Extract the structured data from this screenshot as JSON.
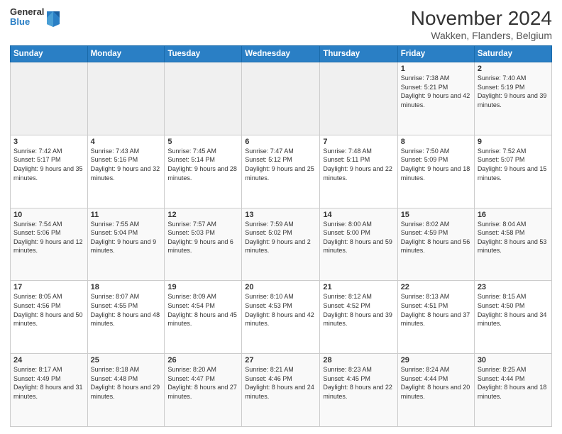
{
  "logo": {
    "line1": "General",
    "line2": "Blue"
  },
  "title": "November 2024",
  "subtitle": "Wakken, Flanders, Belgium",
  "days_header": [
    "Sunday",
    "Monday",
    "Tuesday",
    "Wednesday",
    "Thursday",
    "Friday",
    "Saturday"
  ],
  "weeks": [
    [
      {
        "day": "",
        "info": ""
      },
      {
        "day": "",
        "info": ""
      },
      {
        "day": "",
        "info": ""
      },
      {
        "day": "",
        "info": ""
      },
      {
        "day": "",
        "info": ""
      },
      {
        "day": "1",
        "info": "Sunrise: 7:38 AM\nSunset: 5:21 PM\nDaylight: 9 hours and 42 minutes."
      },
      {
        "day": "2",
        "info": "Sunrise: 7:40 AM\nSunset: 5:19 PM\nDaylight: 9 hours and 39 minutes."
      }
    ],
    [
      {
        "day": "3",
        "info": "Sunrise: 7:42 AM\nSunset: 5:17 PM\nDaylight: 9 hours and 35 minutes."
      },
      {
        "day": "4",
        "info": "Sunrise: 7:43 AM\nSunset: 5:16 PM\nDaylight: 9 hours and 32 minutes."
      },
      {
        "day": "5",
        "info": "Sunrise: 7:45 AM\nSunset: 5:14 PM\nDaylight: 9 hours and 28 minutes."
      },
      {
        "day": "6",
        "info": "Sunrise: 7:47 AM\nSunset: 5:12 PM\nDaylight: 9 hours and 25 minutes."
      },
      {
        "day": "7",
        "info": "Sunrise: 7:48 AM\nSunset: 5:11 PM\nDaylight: 9 hours and 22 minutes."
      },
      {
        "day": "8",
        "info": "Sunrise: 7:50 AM\nSunset: 5:09 PM\nDaylight: 9 hours and 18 minutes."
      },
      {
        "day": "9",
        "info": "Sunrise: 7:52 AM\nSunset: 5:07 PM\nDaylight: 9 hours and 15 minutes."
      }
    ],
    [
      {
        "day": "10",
        "info": "Sunrise: 7:54 AM\nSunset: 5:06 PM\nDaylight: 9 hours and 12 minutes."
      },
      {
        "day": "11",
        "info": "Sunrise: 7:55 AM\nSunset: 5:04 PM\nDaylight: 9 hours and 9 minutes."
      },
      {
        "day": "12",
        "info": "Sunrise: 7:57 AM\nSunset: 5:03 PM\nDaylight: 9 hours and 6 minutes."
      },
      {
        "day": "13",
        "info": "Sunrise: 7:59 AM\nSunset: 5:02 PM\nDaylight: 9 hours and 2 minutes."
      },
      {
        "day": "14",
        "info": "Sunrise: 8:00 AM\nSunset: 5:00 PM\nDaylight: 8 hours and 59 minutes."
      },
      {
        "day": "15",
        "info": "Sunrise: 8:02 AM\nSunset: 4:59 PM\nDaylight: 8 hours and 56 minutes."
      },
      {
        "day": "16",
        "info": "Sunrise: 8:04 AM\nSunset: 4:58 PM\nDaylight: 8 hours and 53 minutes."
      }
    ],
    [
      {
        "day": "17",
        "info": "Sunrise: 8:05 AM\nSunset: 4:56 PM\nDaylight: 8 hours and 50 minutes."
      },
      {
        "day": "18",
        "info": "Sunrise: 8:07 AM\nSunset: 4:55 PM\nDaylight: 8 hours and 48 minutes."
      },
      {
        "day": "19",
        "info": "Sunrise: 8:09 AM\nSunset: 4:54 PM\nDaylight: 8 hours and 45 minutes."
      },
      {
        "day": "20",
        "info": "Sunrise: 8:10 AM\nSunset: 4:53 PM\nDaylight: 8 hours and 42 minutes."
      },
      {
        "day": "21",
        "info": "Sunrise: 8:12 AM\nSunset: 4:52 PM\nDaylight: 8 hours and 39 minutes."
      },
      {
        "day": "22",
        "info": "Sunrise: 8:13 AM\nSunset: 4:51 PM\nDaylight: 8 hours and 37 minutes."
      },
      {
        "day": "23",
        "info": "Sunrise: 8:15 AM\nSunset: 4:50 PM\nDaylight: 8 hours and 34 minutes."
      }
    ],
    [
      {
        "day": "24",
        "info": "Sunrise: 8:17 AM\nSunset: 4:49 PM\nDaylight: 8 hours and 31 minutes."
      },
      {
        "day": "25",
        "info": "Sunrise: 8:18 AM\nSunset: 4:48 PM\nDaylight: 8 hours and 29 minutes."
      },
      {
        "day": "26",
        "info": "Sunrise: 8:20 AM\nSunset: 4:47 PM\nDaylight: 8 hours and 27 minutes."
      },
      {
        "day": "27",
        "info": "Sunrise: 8:21 AM\nSunset: 4:46 PM\nDaylight: 8 hours and 24 minutes."
      },
      {
        "day": "28",
        "info": "Sunrise: 8:23 AM\nSunset: 4:45 PM\nDaylight: 8 hours and 22 minutes."
      },
      {
        "day": "29",
        "info": "Sunrise: 8:24 AM\nSunset: 4:44 PM\nDaylight: 8 hours and 20 minutes."
      },
      {
        "day": "30",
        "info": "Sunrise: 8:25 AM\nSunset: 4:44 PM\nDaylight: 8 hours and 18 minutes."
      }
    ]
  ]
}
